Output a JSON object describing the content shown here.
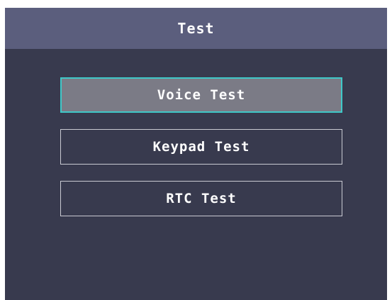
{
  "title": "Test",
  "menu": {
    "items": [
      {
        "label": "Voice Test",
        "selected": true
      },
      {
        "label": "Keypad Test",
        "selected": false
      },
      {
        "label": "RTC Test",
        "selected": false
      }
    ]
  },
  "colors": {
    "background": "#383a4e",
    "title_bar": "#5b5e7d",
    "selected_fill": "#7b7b86",
    "selected_border": "#3fc8c8",
    "button_border": "#c9cad2"
  }
}
